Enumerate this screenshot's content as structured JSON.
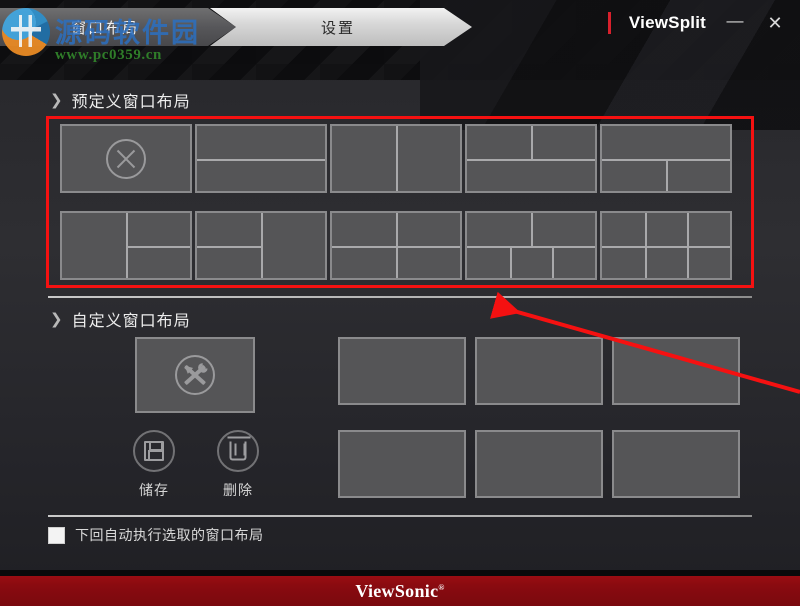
{
  "window": {
    "app_title": "ViewSplit",
    "minimize_label": "—",
    "close_label": "✕",
    "accent_color": "#d8202c"
  },
  "watermark": {
    "text_cn": "源码软件园",
    "url": "www.pc0359.cn",
    "logo_name": "watermark-logo"
  },
  "tabs": [
    {
      "label": "窗口布局",
      "active": false
    },
    {
      "label": "设置",
      "active": true
    }
  ],
  "predefined": {
    "heading": "预定义窗口布局",
    "chevron": "❯",
    "highlight_color": "#f51111",
    "layouts": [
      {
        "name": "none",
        "icon": "close-circle-icon"
      },
      {
        "name": "two-rows"
      },
      {
        "name": "two-columns"
      },
      {
        "name": "top-split-bottom-full"
      },
      {
        "name": "top-full-bottom-split"
      },
      {
        "name": "left-full-right-two-rows"
      },
      {
        "name": "left-two-rows-right-full"
      },
      {
        "name": "grid-2x2"
      },
      {
        "name": "top-two-bottom-three"
      },
      {
        "name": "grid-3x2"
      }
    ]
  },
  "custom": {
    "heading": "自定义窗口布局",
    "chevron": "❯",
    "editor_slot_icon": "tools-icon",
    "empty_slots": 6,
    "actions": [
      {
        "label": "储存",
        "icon": "floppy-disk-icon",
        "name": "save"
      },
      {
        "label": "删除",
        "icon": "trash-icon",
        "name": "delete"
      }
    ]
  },
  "options": {
    "auto_apply": {
      "label": "下回自动执行选取的窗口布局",
      "checked": false
    }
  },
  "footer": {
    "brand": "ViewSonic",
    "trademark": "®",
    "bar_color": "#8a0b10"
  },
  "annotation": {
    "arrow_color": "#f51111",
    "points_to": "自定义窗口布局"
  }
}
